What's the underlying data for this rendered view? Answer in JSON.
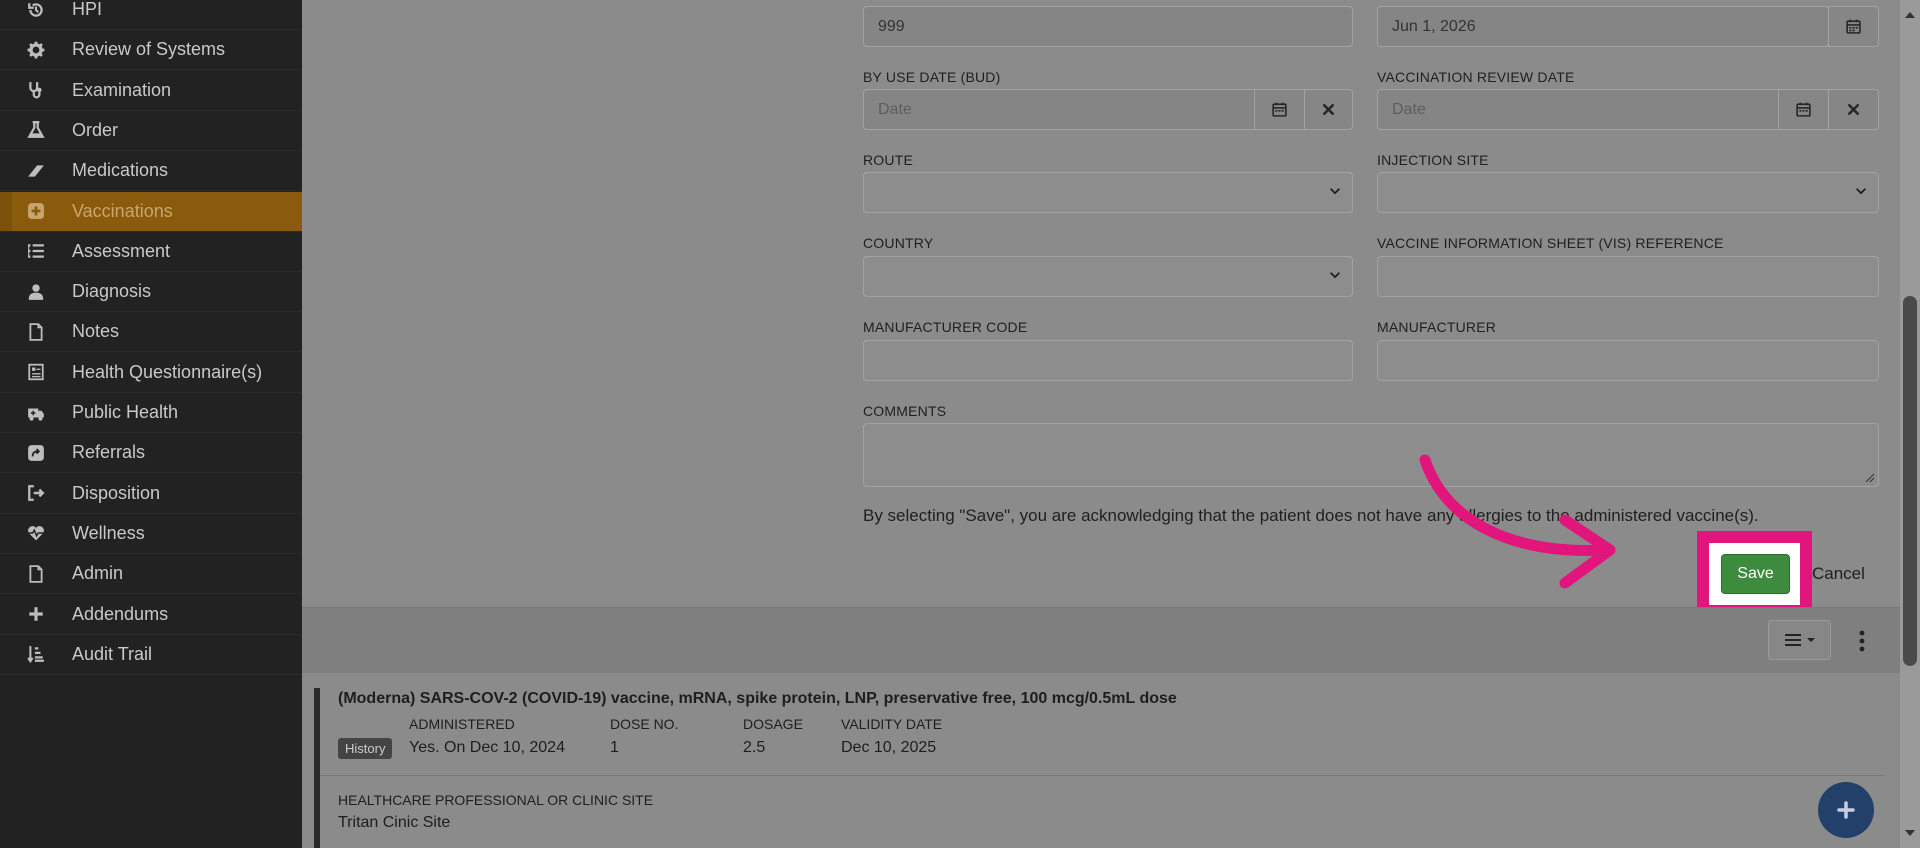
{
  "sidebar": {
    "items": [
      {
        "label": "HPI",
        "icon": "history-icon"
      },
      {
        "label": "Review of Systems",
        "icon": "gear-icon"
      },
      {
        "label": "Examination",
        "icon": "stethoscope-icon"
      },
      {
        "label": "Order",
        "icon": "flask-icon"
      },
      {
        "label": "Medications",
        "icon": "pill-icon"
      },
      {
        "label": "Vaccinations",
        "icon": "plus-square-icon",
        "active": true
      },
      {
        "label": "Assessment",
        "icon": "list-icon"
      },
      {
        "label": "Diagnosis",
        "icon": "user-doctor-icon"
      },
      {
        "label": "Notes",
        "icon": "file-icon"
      },
      {
        "label": "Health Questionnaire(s)",
        "icon": "form-icon"
      },
      {
        "label": "Public Health",
        "icon": "ambulance-icon"
      },
      {
        "label": "Referrals",
        "icon": "share-square-icon"
      },
      {
        "label": "Disposition",
        "icon": "sign-out-icon"
      },
      {
        "label": "Wellness",
        "icon": "heartbeat-icon"
      },
      {
        "label": "Admin",
        "icon": "file-icon"
      },
      {
        "label": "Addendums",
        "icon": "plus-icon"
      },
      {
        "label": "Audit Trail",
        "icon": "sort-amount-icon"
      }
    ]
  },
  "form": {
    "lot_value": "999",
    "expiration_value": "Jun 1, 2026",
    "bud_label": "BY USE DATE (BUD)",
    "bud_placeholder": "Date",
    "review_label": "VACCINATION REVIEW DATE",
    "review_placeholder": "Date",
    "route_label": "ROUTE",
    "site_label": "INJECTION SITE",
    "country_label": "COUNTRY",
    "vis_label": "VACCINE INFORMATION SHEET (VIS) REFERENCE",
    "mfr_code_label": "MANUFACTURER CODE",
    "mfr_label": "MANUFACTURER",
    "comments_label": "COMMENTS",
    "ack_text": "By selecting \"Save\", you are acknowledging that the patient does not have any allergies to the administered vaccine(s).",
    "save_label": "Save",
    "cancel_label": "Cancel"
  },
  "record": {
    "title": "(Moderna) SARS-COV-2 (COVID-19) vaccine, mRNA, spike protein, LNP, preservative free, 100 mcg/0.5mL dose",
    "badge": "History",
    "administered_label": "ADMINISTERED",
    "administered_value": "Yes. On Dec 10, 2024",
    "dose_label": "DOSE NO.",
    "dose_value": "1",
    "dosage_label": "DOSAGE",
    "dosage_value": "2.5",
    "validity_label": "VALIDITY DATE",
    "validity_value": "Dec 10, 2025",
    "hcp_label": "HEALTHCARE PROFESSIONAL OR CLINIC SITE",
    "hcp_value": "Tritan Cinic Site"
  },
  "colors": {
    "active_nav": "#8a5b0d",
    "save_button": "#3d8b3d",
    "highlight": "#e2157d",
    "fab": "#23406a"
  }
}
